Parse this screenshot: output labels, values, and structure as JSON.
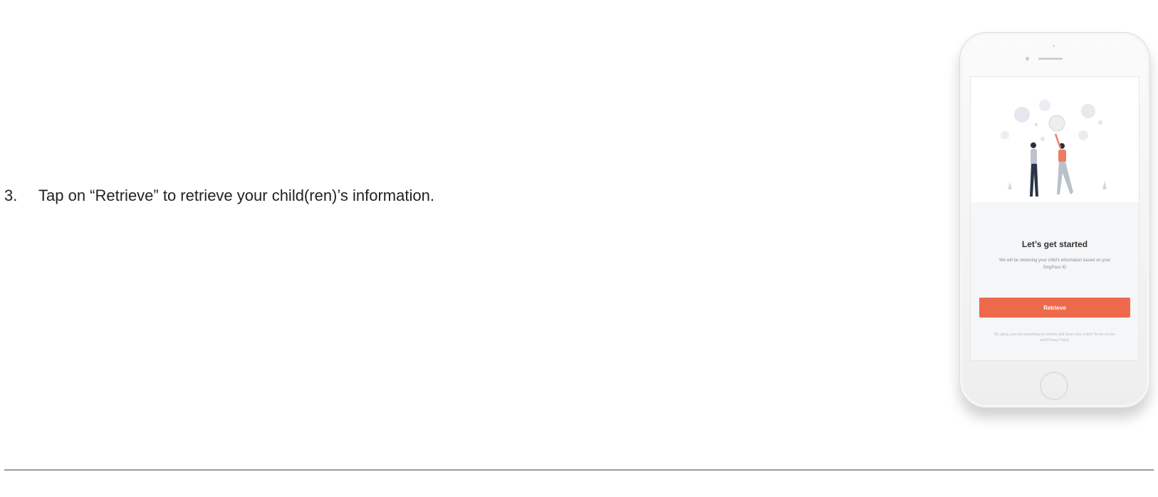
{
  "instruction": {
    "number": "3.",
    "text": "Tap on “Retrieve” to retrieve your child(ren)’s information."
  },
  "phone_screen": {
    "title": "Let’s get started",
    "description": "We will be retrieving your child’s information based on your SingPass ID",
    "retrieve_button": "Retrieve",
    "footnote": "By using, you are consenting to retrieve and share your child’s Terms of Use and Privacy Policy"
  },
  "colors": {
    "accent": "#ee6a4d",
    "divider": "#9a9a9a"
  }
}
